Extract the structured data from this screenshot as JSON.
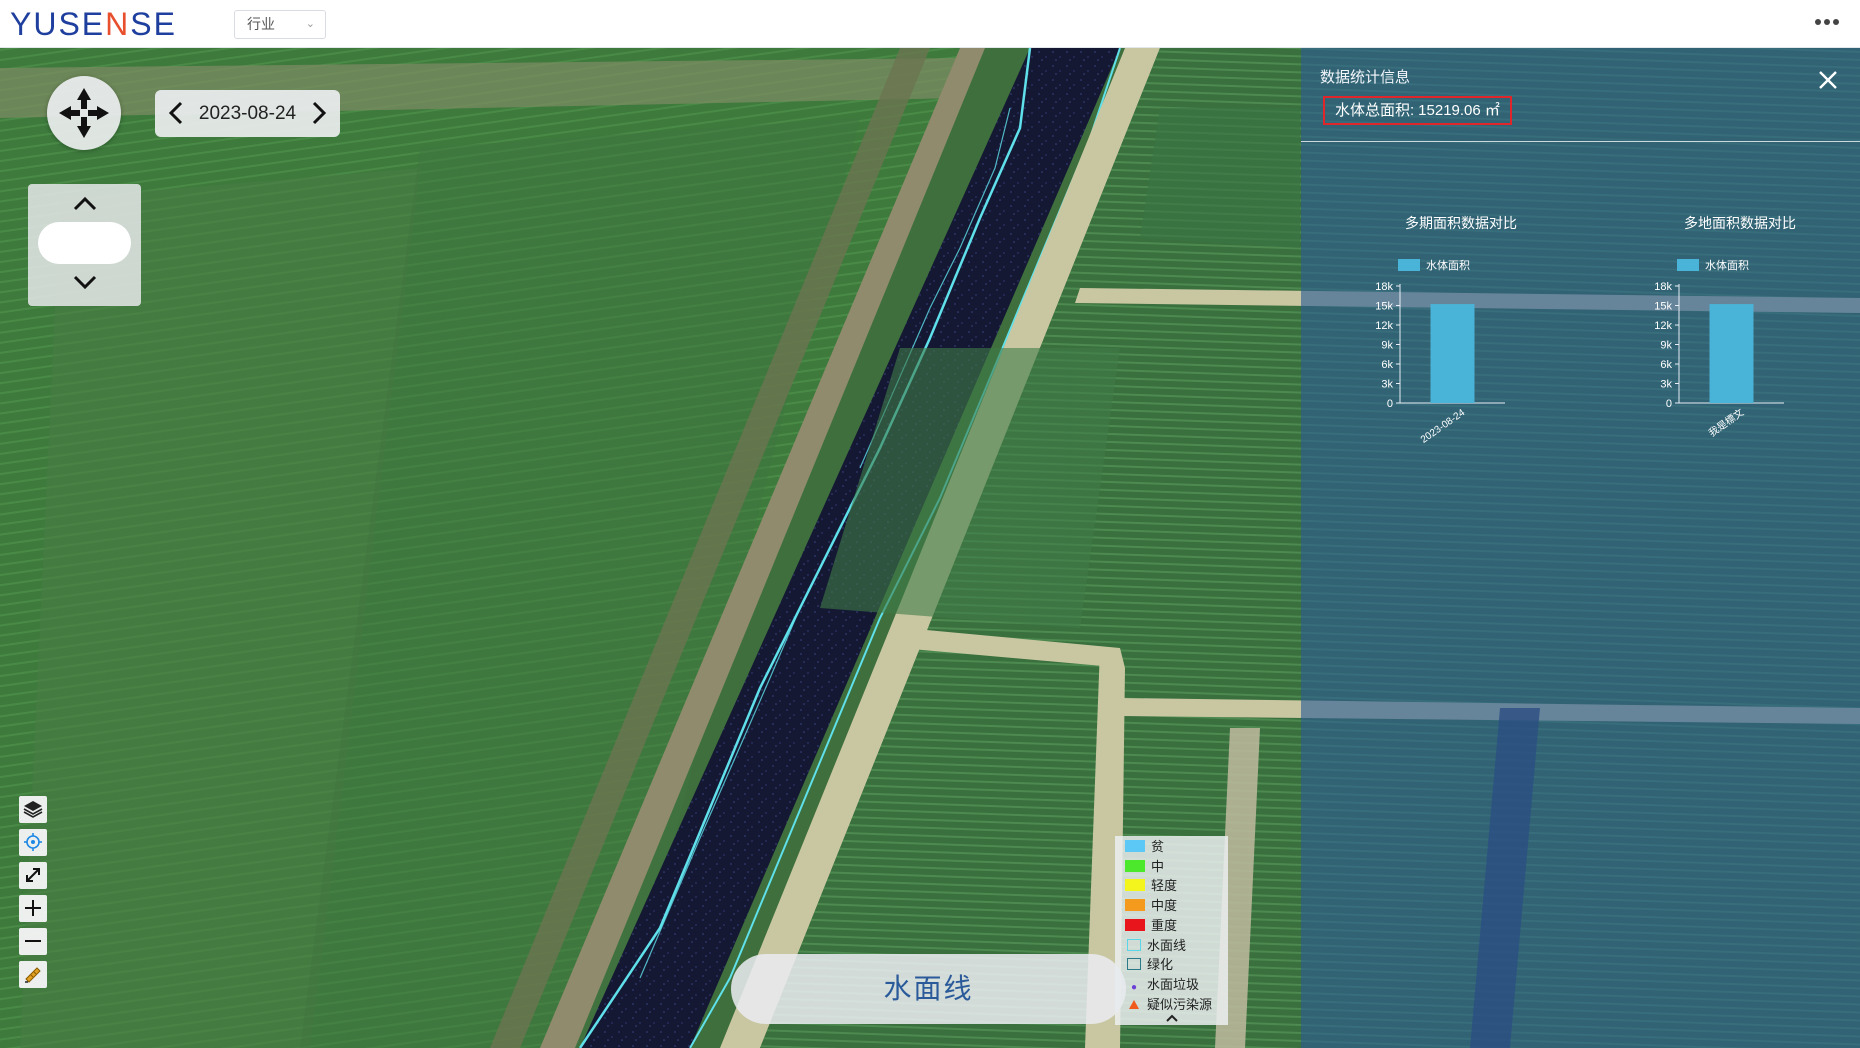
{
  "header": {
    "logo_text_main": "YUSE",
    "logo_text_accent": "N",
    "logo_text_tail": "SE",
    "industry_select": {
      "value": "行业"
    },
    "more_icon": "more-horizontal-icon"
  },
  "map": {
    "date": "2023-08-24",
    "prev_icon": "chevron-left-icon",
    "next_icon": "chevron-right-icon",
    "compass_icon": "compass-arrows-icon",
    "zoom_up_icon": "chevron-up-icon",
    "zoom_down_icon": "chevron-down-icon",
    "tools": [
      "layers-icon",
      "locate-icon",
      "fullscreen-icon",
      "zoom-in-icon",
      "zoom-out-icon",
      "ruler-icon"
    ],
    "layer_toggle_label": "水面线"
  },
  "stats": {
    "title": "数据统计信息",
    "total_label": "水体总面积:",
    "total_value": "15219.06 ㎡",
    "close_icon": "close-icon",
    "bar_color": "#4ab3d8"
  },
  "chart_data": [
    {
      "type": "bar",
      "title": "多期面积数据对比",
      "legend": [
        "水体面积"
      ],
      "legend_position": "top-left",
      "categories": [
        "2023-08-24"
      ],
      "series": [
        {
          "name": "水体面积",
          "values": [
            15219.06
          ]
        }
      ],
      "ylim": [
        0,
        18000
      ],
      "yticks": [
        "0",
        "3k",
        "6k",
        "9k",
        "12k",
        "15k",
        "18k"
      ]
    },
    {
      "type": "bar",
      "title": "多地面积数据对比",
      "legend": [
        "水体面积"
      ],
      "legend_position": "top-left",
      "categories": [
        "我是標文"
      ],
      "series": [
        {
          "name": "水体面积",
          "values": [
            15219.06
          ]
        }
      ],
      "ylim": [
        0,
        18000
      ],
      "yticks": [
        "0",
        "3k",
        "6k",
        "9k",
        "12k",
        "15k",
        "18k"
      ]
    }
  ],
  "legend": {
    "items": [
      {
        "label": "贫",
        "kind": "fill",
        "color": "#5cc8f5"
      },
      {
        "label": "中",
        "kind": "fill",
        "color": "#4ce82c"
      },
      {
        "label": "轻度",
        "kind": "fill",
        "color": "#f4f51c"
      },
      {
        "label": "中度",
        "kind": "fill",
        "color": "#f49a1c"
      },
      {
        "label": "重度",
        "kind": "fill",
        "color": "#e8161c"
      },
      {
        "label": "水面线",
        "kind": "box",
        "color": "#59d7e8"
      },
      {
        "label": "绿化",
        "kind": "box",
        "color": "#2a7a8a"
      },
      {
        "label": "水面垃圾",
        "kind": "dot",
        "color": "#6c3fd6"
      },
      {
        "label": "疑似污染源",
        "kind": "tri",
        "color": "#f05a1c"
      }
    ],
    "collapse_icon": "chevron-up-icon"
  }
}
